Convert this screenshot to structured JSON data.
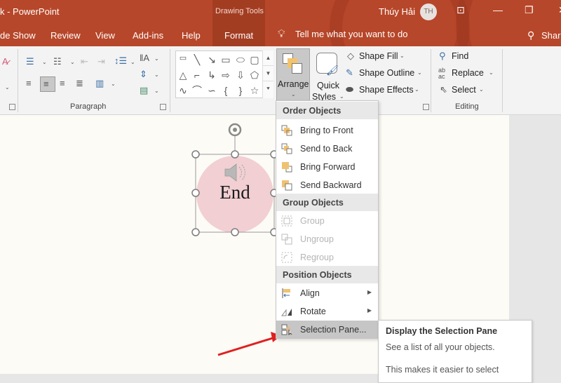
{
  "window": {
    "title": "k  -  PowerPoint",
    "context_tab_group": "Drawing Tools",
    "user_name": "Thúy Hải",
    "user_initials": "TH",
    "controls": [
      "ribbon-display-options",
      "minimize",
      "restore",
      "close"
    ]
  },
  "tabs": [
    {
      "label": "de Show"
    },
    {
      "label": "Review"
    },
    {
      "label": "View"
    },
    {
      "label": "Add-ins"
    },
    {
      "label": "Help"
    },
    {
      "label": "Format",
      "active": true
    }
  ],
  "tell_me": {
    "placeholder": "Tell me what you want to do"
  },
  "share_label": "Share",
  "ribbon": {
    "paragraph_group_label": "Paragraph",
    "drawing": {
      "arrange_label": "Arrange",
      "quick_styles_line1": "Quick",
      "quick_styles_line2": "Styles",
      "shape_fill": "Shape Fill",
      "shape_outline": "Shape Outline",
      "shape_effects": "Shape Effects"
    },
    "editing": {
      "group_label": "Editing",
      "find": "Find",
      "replace": "Replace",
      "select": "Select"
    }
  },
  "slide": {
    "shape_text": "End",
    "shape_fill_color": "#f2cfd2"
  },
  "arrange_menu": {
    "sections": [
      {
        "header": "Order Objects",
        "items": [
          {
            "label": "Bring to Front",
            "icon": "bring-to-front-icon",
            "enabled": true
          },
          {
            "label": "Send to Back",
            "icon": "send-to-back-icon",
            "enabled": true
          },
          {
            "label": "Bring Forward",
            "icon": "bring-forward-icon",
            "enabled": true
          },
          {
            "label": "Send Backward",
            "icon": "send-backward-icon",
            "enabled": true
          }
        ]
      },
      {
        "header": "Group Objects",
        "items": [
          {
            "label": "Group",
            "icon": "group-icon",
            "enabled": false
          },
          {
            "label": "Ungroup",
            "icon": "ungroup-icon",
            "enabled": false
          },
          {
            "label": "Regroup",
            "icon": "regroup-icon",
            "enabled": false
          }
        ]
      },
      {
        "header": "Position Objects",
        "items": [
          {
            "label": "Align",
            "icon": "align-icon",
            "enabled": true,
            "submenu": true
          },
          {
            "label": "Rotate",
            "icon": "rotate-icon",
            "enabled": true,
            "submenu": true
          },
          {
            "label": "Selection Pane...",
            "icon": "selection-pane-icon",
            "enabled": true,
            "highlighted": true
          }
        ]
      }
    ]
  },
  "tooltip": {
    "title": "Display the Selection Pane",
    "line1": "See a list of all your objects.",
    "line2": "This makes it easier to select"
  },
  "colors": {
    "title_bar": "#b7472a",
    "context_tab": "#a33d22",
    "annotation_arrow": "#e02020"
  }
}
